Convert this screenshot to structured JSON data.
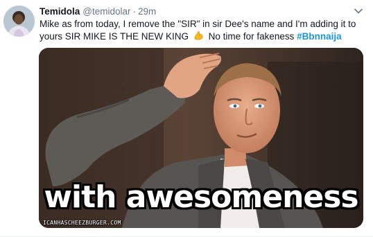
{
  "tweet": {
    "display_name": "Temidola",
    "handle": "@temidolar",
    "separator": "·",
    "time": "29m",
    "text_main": "Mike as from today, I remove the \"SIR\" in sir Dee's name and I'm adding it to yours SIR MIKE IS THE NEW KING",
    "emoji_icon": "flexed-biceps-icon",
    "text_after_emoji": "No time for fakeness",
    "hashtag": "#Bbnnaija"
  },
  "media": {
    "caption": "with awesomeness",
    "watermark": "ICANHASCHEEZBURGER.COM"
  },
  "colors": {
    "link": "#1b95e0",
    "secondary_text": "#657786",
    "primary_text": "#14171a"
  }
}
